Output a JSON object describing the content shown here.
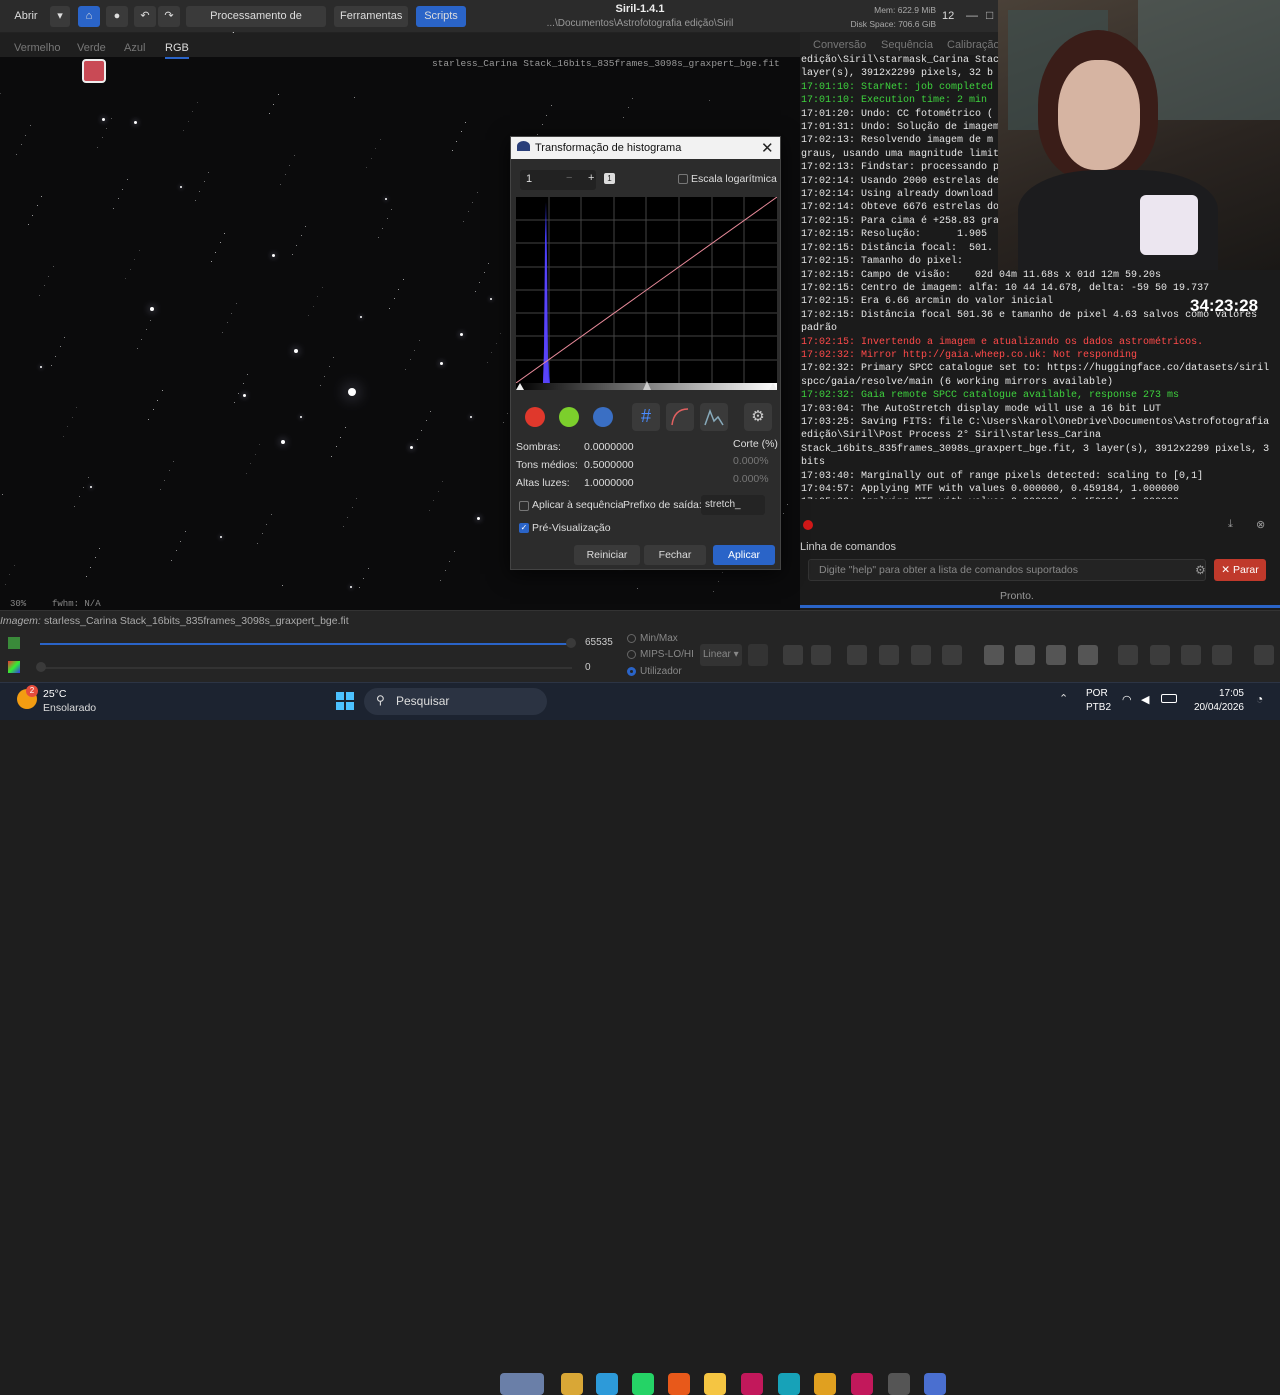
{
  "window": {
    "title": "Siril-1.4.1",
    "path": "...\\Documentos\\Astrofotografia edição\\Siril",
    "mem": "Mem: 622.9 MiB",
    "disk": "Disk Space: 706.6 GiB",
    "threads": "12"
  },
  "toolbar": {
    "open_label": "Abrir",
    "image_processing_label": "Processamento de imagem",
    "tools_label": "Ferramentas",
    "scripts_label": "Scripts"
  },
  "channels": {
    "tabs": [
      "Vermelho",
      "Verde",
      "Azul",
      "RGB"
    ],
    "active": "RGB"
  },
  "image": {
    "filename_overlay": "starless_Carina Stack_16bits_835frames_3098s_graxpert_bge.fit",
    "zoom": "30%",
    "fwhm": "fwhm: N/A"
  },
  "right_tabs": [
    "Conversão",
    "Sequência",
    "Calibração"
  ],
  "log": [
    {
      "t": "edição\\Siril\\starmask_Carina Stac",
      "c": ""
    },
    {
      "t": "layer(s), 3912x2299 pixels, 32 b",
      "c": ""
    },
    {
      "t": "17:01:10: StarNet: job completed",
      "c": "g"
    },
    {
      "t": "17:01:10: Execution time: 2 min",
      "c": "g"
    },
    {
      "t": "17:01:20: Undo: CC fotométrico (",
      "c": ""
    },
    {
      "t": "17:01:31: Undo: Solução de imagem",
      "c": ""
    },
    {
      "t": "17:02:13: Resolvendo imagem de m",
      "c": ""
    },
    {
      "t": "graus, usando uma magnitude limit",
      "c": ""
    },
    {
      "t": "17:02:13: Findstar: processando p",
      "c": ""
    },
    {
      "t": "17:02:14: Usando 2000 estrelas de",
      "c": ""
    },
    {
      "t": "17:02:14: Using already download",
      "c": ""
    },
    {
      "t": "17:02:14: Obteve 6676 estrelas do",
      "c": ""
    },
    {
      "t": "17:02:15: Para cima é +258.83 gra",
      "c": ""
    },
    {
      "t": "17:02:15: Resolução:      1.905",
      "c": ""
    },
    {
      "t": "17:02:15: Distância focal:  501.",
      "c": ""
    },
    {
      "t": "17:02:15: Tamanho do pixel:",
      "c": ""
    },
    {
      "t": "17:02:15: Campo de visão:    02d 04m 11.68s x 01d 12m 59.20s",
      "c": ""
    },
    {
      "t": "17:02:15: Centro de imagem: alfa: 10 44 14.678, delta: -59 50 19.737",
      "c": ""
    },
    {
      "t": "17:02:15: Era 6.66 arcmin do valor inicial",
      "c": ""
    },
    {
      "t": "17:02:15: Distância focal 501.36 e tamanho de pixel 4.63 salvos como valores",
      "c": ""
    },
    {
      "t": "padrão",
      "c": ""
    },
    {
      "t": "17:02:15: Invertendo a imagem e atualizando os dados astrométricos.",
      "c": "r"
    },
    {
      "t": "17:02:32: Mirror http://gaia.wheep.co.uk: Not responding",
      "c": "r"
    },
    {
      "t": "17:02:32: Primary SPCC catalogue set to: https://huggingface.co/datasets/siril",
      "c": ""
    },
    {
      "t": "spcc/gaia/resolve/main (6 working mirrors available)",
      "c": ""
    },
    {
      "t": "17:02:32: Gaia remote SPCC catalogue available, response 273 ms",
      "c": "g"
    },
    {
      "t": "17:03:04: The AutoStretch display mode will use a 16 bit LUT",
      "c": ""
    },
    {
      "t": "17:03:25: Saving FITS: file C:\\Users\\karol\\OneDrive\\Documentos\\Astrofotografia",
      "c": ""
    },
    {
      "t": "edição\\Siril\\Post Process 2° Siril\\starless_Carina",
      "c": ""
    },
    {
      "t": "Stack_16bits_835frames_3098s_graxpert_bge.fit, 3 layer(s), 3912x2299 pixels, 3",
      "c": ""
    },
    {
      "t": "bits",
      "c": ""
    },
    {
      "t": "17:03:40: Marginally out of range pixels detected: scaling to [0,1]",
      "c": ""
    },
    {
      "t": "17:04:57: Applying MTF with values 0.000000, 0.459184, 1.000000",
      "c": ""
    },
    {
      "t": "17:05:02: Applying MTF with values 0.000000, 0.459184, 1.000000",
      "c": ""
    }
  ],
  "timer": "34:23:28",
  "command": {
    "section_label": "Linha de comandos",
    "placeholder": "Digite \"help\" para obter a lista de comandos suportados",
    "stop_label": "Parar",
    "status": "Pronto."
  },
  "dialog": {
    "title": "Transformação de histograma",
    "zoom_value": "1",
    "log_scale_label": "Escala logarítmica",
    "shadows_label": "Sombras:",
    "shadows_value": "0.0000000",
    "midtones_label": "Tons médios:",
    "midtones_value": "0.5000000",
    "highlights_label": "Altas luzes:",
    "highlights_value": "1.0000000",
    "clip_label": "Corte (%)",
    "clip_low": "0.000%",
    "clip_high": "0.000%",
    "apply_seq_label": "Aplicar à sequência",
    "prefix_label": "Prefixo de saída:",
    "prefix_value": "stretch_",
    "preview_label": "Pré-Visualização",
    "reset_label": "Reiniciar",
    "close_label": "Fechar",
    "apply_label": "Aplicar"
  },
  "bottom": {
    "image_label": "Imagem:",
    "image_name": "starless_Carina Stack_16bits_835frames_3098s_graxpert_bge.fit",
    "max_value": "65535",
    "min_value": "0",
    "mode_options": [
      "Min/Max",
      "MIPS-LO/HI",
      "Utilizador"
    ],
    "selected_mode": "Utilizador",
    "stretch_mode": "Linear"
  },
  "taskbar": {
    "weather_temp": "25°C",
    "weather_desc": "Ensolarado",
    "weather_badge": "2",
    "search_label": "Pesquisar",
    "lang1": "POR",
    "lang2": "PTB2",
    "time": "17:05",
    "date": "20/04/2026"
  }
}
